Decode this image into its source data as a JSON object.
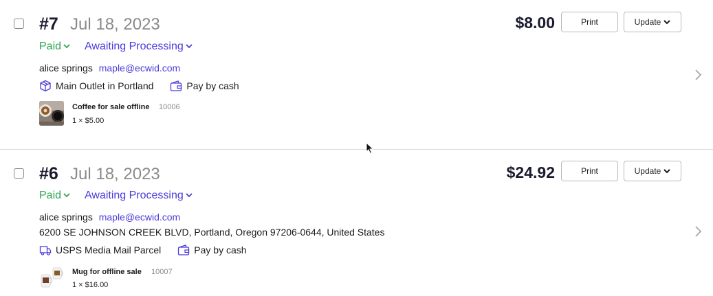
{
  "orders": [
    {
      "number": "#7",
      "date": "Jul 18, 2023",
      "payment_status": "Paid",
      "fulfillment_status": "Awaiting Processing",
      "customer_name": "alice springs",
      "customer_email": "maple@ecwid.com",
      "address": "",
      "delivery_icon": "box-icon",
      "delivery": "Main Outlet in Portland",
      "payment_icon": "wallet-icon",
      "payment_method": "Pay by cash",
      "product": {
        "name": "Coffee for sale offline",
        "sku": "10006",
        "qty_price": "1 × $5.00",
        "thumb": "coffee-thumbnail"
      },
      "total": "$8.00",
      "print_label": "Print",
      "update_label": "Update"
    },
    {
      "number": "#6",
      "date": "Jul 18, 2023",
      "payment_status": "Paid",
      "fulfillment_status": "Awaiting Processing",
      "customer_name": "alice springs",
      "customer_email": "maple@ecwid.com",
      "address": "6200 SE JOHNSON CREEK BLVD, Portland, Oregon 97206-0644, United States",
      "delivery_icon": "truck-icon",
      "delivery": "USPS Media Mail Parcel",
      "payment_icon": "wallet-icon",
      "payment_method": "Pay by cash",
      "product": {
        "name": "Mug for offline sale",
        "sku": "10007",
        "qty_price": "1 × $16.00",
        "thumb": "mug-thumbnail"
      },
      "total": "$24.92",
      "print_label": "Print",
      "update_label": "Update"
    }
  ],
  "colors": {
    "paid": "#2ea44f",
    "link": "#4a3bdb",
    "muted": "#8a8a8a",
    "title": "#1a1a2e"
  }
}
